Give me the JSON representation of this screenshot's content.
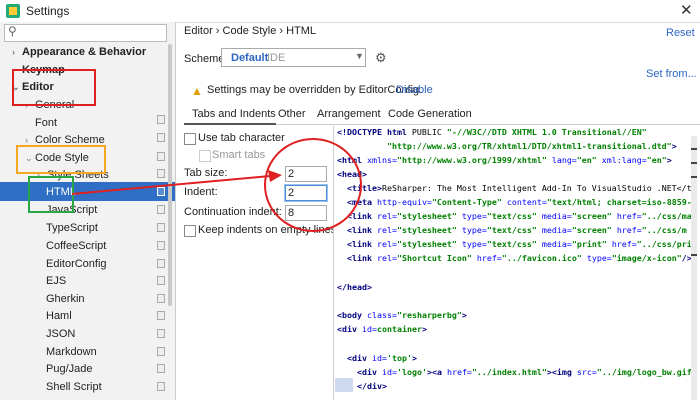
{
  "window": {
    "title": "Settings",
    "close": "✕"
  },
  "search": {
    "icon": "⚲"
  },
  "sidebar": {
    "items": [
      {
        "label": "Appearance & Behavior",
        "arrow": "›"
      },
      {
        "label": "Keymap"
      },
      {
        "label": "Editor",
        "arrow": "⌄"
      },
      {
        "label": "General",
        "arrow": "›"
      },
      {
        "label": "Font"
      },
      {
        "label": "Color Scheme",
        "arrow": "›"
      },
      {
        "label": "Code Style",
        "arrow": "⌄"
      },
      {
        "label": "Style Sheets",
        "arrow": "›"
      },
      {
        "label": "HTML"
      },
      {
        "label": "JavaScript"
      },
      {
        "label": "TypeScript"
      },
      {
        "label": "CoffeeScript"
      },
      {
        "label": "EditorConfig"
      },
      {
        "label": "EJS"
      },
      {
        "label": "Gherkin"
      },
      {
        "label": "Haml"
      },
      {
        "label": "JSON"
      },
      {
        "label": "Markdown"
      },
      {
        "label": "Pug/Jade"
      },
      {
        "label": "Shell Script"
      }
    ]
  },
  "header": {
    "breadcrumb": "Editor  ›  Code Style  ›  HTML",
    "reset": "Reset",
    "scheme_label": "Scheme:",
    "scheme_value": "Default",
    "scheme_scope": "IDE",
    "set_from": "Set from...",
    "warning": "Settings may be overridden by EditorConfig.",
    "disable": "Disable"
  },
  "tabs": [
    "Tabs and Indents",
    "Other",
    "Arrangement",
    "Code Generation"
  ],
  "options": {
    "use_tab": "Use tab character",
    "smart_tabs": "Smart tabs",
    "tab_size_label": "Tab size:",
    "tab_size": "2",
    "indent_label": "Indent:",
    "indent": "2",
    "continuation_label": "Continuation indent:",
    "continuation": "8",
    "keep_indents": "Keep indents on empty lines"
  },
  "colors": {
    "accent": "#2f6fc6",
    "link": "#2b64c5",
    "annotation_red": "#e02020",
    "annotation_orange": "#f5a623",
    "annotation_green": "#28a745"
  }
}
